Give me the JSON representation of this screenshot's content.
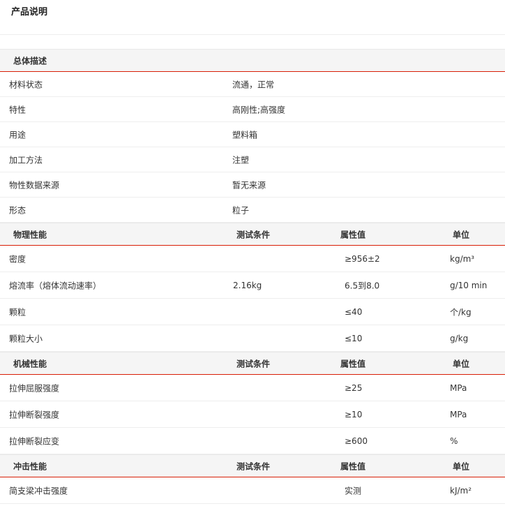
{
  "page_title": "产品说明",
  "general": {
    "header": "总体描述",
    "rows": [
      {
        "name": "材料状态",
        "value": "流通，正常"
      },
      {
        "name": "特性",
        "value": "高刚性;高强度"
      },
      {
        "name": "用途",
        "value": "塑料箱"
      },
      {
        "name": "加工方法",
        "value": "注塑"
      },
      {
        "name": "物性数据来源",
        "value": "暂无来源"
      },
      {
        "name": "形态",
        "value": "粒子"
      }
    ]
  },
  "physical": {
    "header": {
      "name": "物理性能",
      "cond": "测试条件",
      "prop": "属性值",
      "unit": "单位"
    },
    "rows": [
      {
        "name": "密度",
        "cond": "",
        "prop": "≥956±2",
        "unit": "kg/m³"
      },
      {
        "name": "熔流率（熔体流动速率）",
        "cond": "2.16kg",
        "prop": "6.5到8.0",
        "unit": "g/10 min"
      },
      {
        "name": "颗粒",
        "cond": "",
        "prop": "≤40",
        "unit": "个/kg"
      },
      {
        "name": "颗粒大小",
        "cond": "",
        "prop": "≤10",
        "unit": "g/kg"
      }
    ]
  },
  "mechanical": {
    "header": {
      "name": "机械性能",
      "cond": "测试条件",
      "prop": "属性值",
      "unit": "单位"
    },
    "rows": [
      {
        "name": "拉伸屈服强度",
        "cond": "",
        "prop": "≥25",
        "unit": "MPa"
      },
      {
        "name": "拉伸断裂强度",
        "cond": "",
        "prop": "≥10",
        "unit": "MPa"
      },
      {
        "name": "拉伸断裂应变",
        "cond": "",
        "prop": "≥600",
        "unit": "%"
      }
    ]
  },
  "impact": {
    "header": {
      "name": "冲击性能",
      "cond": "测试条件",
      "prop": "属性值",
      "unit": "单位"
    },
    "rows": [
      {
        "name": "简支梁冲击强度",
        "cond": "",
        "prop": "实测",
        "unit": "kJ/m²"
      }
    ]
  },
  "colors": {
    "accent_rule": "#d81e06",
    "header_bg": "#f5f5f5"
  }
}
